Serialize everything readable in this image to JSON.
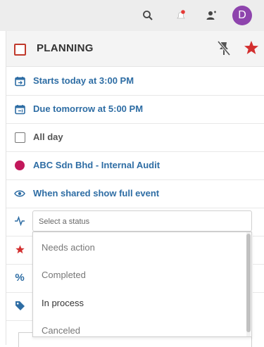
{
  "topbar": {
    "avatar_initial": "D",
    "avatar_color": "#8e44ad"
  },
  "header": {
    "title": "PLANNING"
  },
  "rows": [
    {
      "label": "Starts today at 3:00 PM",
      "icon": "calendar-start-icon"
    },
    {
      "label": "Due tomorrow at 5:00 PM",
      "icon": "calendar-due-icon"
    },
    {
      "label": "All day",
      "icon": "checkbox-icon"
    },
    {
      "label": "ABC Sdn Bhd - Internal Audit",
      "icon": "calendar-color-dot",
      "color": "#c2185b"
    },
    {
      "label": "When shared show full event",
      "icon": "eye-icon"
    }
  ],
  "status": {
    "placeholder": "Select a status",
    "options": [
      "Needs action",
      "Completed",
      "In process",
      "Canceled"
    ]
  },
  "colors": {
    "accent_blue": "#2e6da4",
    "accent_red": "#d32f2f",
    "topbar_bg": "#ededed"
  }
}
